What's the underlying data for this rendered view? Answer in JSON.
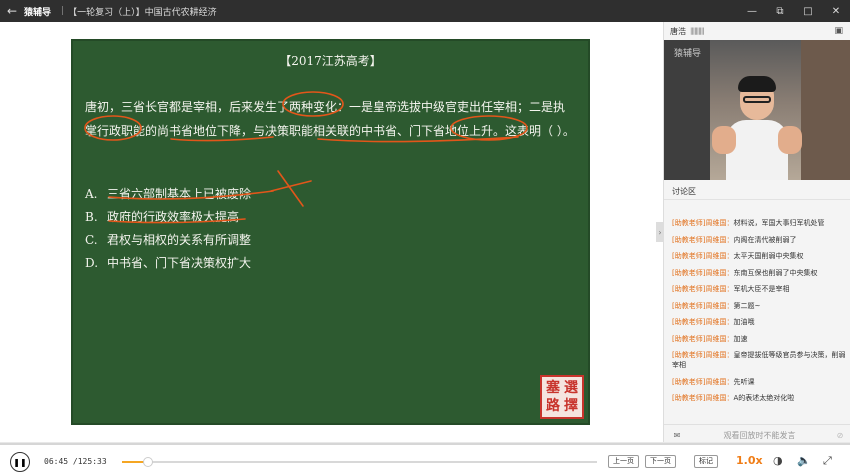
{
  "titlebar": {
    "back_icon": "arrow-left-icon",
    "app_name": "猿辅导",
    "separator": "|",
    "course_title": "【一轮复习（上）】中国古代农耕经济",
    "controls": [
      "minimize-icon",
      "restore-icon",
      "maximize-icon",
      "close-icon"
    ]
  },
  "board": {
    "title": "【2017江苏高考】",
    "question": "唐初，三省长官都是宰相，后来发生了两种变化：一是皇帝选拔中级官吏出任宰相；二是执掌行政职能的尚书省地位下降，与决策职能相关联的中书省、门下省地位上升。这表明（ ）。",
    "options": [
      {
        "key": "A.",
        "text": "三省六部制基本上已被废除"
      },
      {
        "key": "B.",
        "text": "政府的行政效率极大提高"
      },
      {
        "key": "C.",
        "text": "君权与相权的关系有所调整"
      },
      {
        "key": "D.",
        "text": "中书省、门下省决策权扩大"
      }
    ],
    "seal_chars": [
      "選",
      "塞",
      "擇",
      "路"
    ],
    "ink_color": "#e2561a"
  },
  "teacher": {
    "name": "唐浩",
    "signal": "||||||||||",
    "camera_icon": "camera-off-icon",
    "watermark": "猿辅导"
  },
  "discussion": {
    "title": "讨论区",
    "collapse_icon": "chevron-right-icon",
    "messages": [
      {
        "who": "[助教老师]周维国：",
        "text": "材料说，军国大事归军机处管"
      },
      {
        "who": "[助教老师]周维国：",
        "text": "内阁在清代被削弱了"
      },
      {
        "who": "[助教老师]周维国：",
        "text": "太平天国削弱中央集权"
      },
      {
        "who": "[助教老师]周维国：",
        "text": "东南互保也削弱了中央集权"
      },
      {
        "who": "[助教老师]周维国：",
        "text": "军机大臣不是宰相"
      },
      {
        "who": "[助教老师]周维国：",
        "text": "第二题~"
      },
      {
        "who": "[助教老师]周维国：",
        "text": "加油哦"
      },
      {
        "who": "[助教老师]周维国：",
        "text": "加速"
      },
      {
        "who": "[助教老师]周维国：",
        "text": "皇帝提拔低等级官员参与决策，削弱宰相"
      },
      {
        "who": "[助教老师]周维国：",
        "text": "先听课"
      },
      {
        "who": "[助教老师]周维国：",
        "text": "A的表述太绝对化啦"
      }
    ],
    "input_placeholder": "观看回放时不能发言",
    "input_icon": "chat-icon",
    "disabled_icon": "forbidden-icon"
  },
  "player": {
    "play_icon": "pause-icon",
    "current_time": "06:45",
    "total_time": "/125:33",
    "progress": 0.054,
    "prev_label": "上一页",
    "next_label": "下一页",
    "mark_label": "标记",
    "speed": "1.0x",
    "accent": "#f5a623",
    "right_icons": [
      "subtitle-icon",
      "volume-icon",
      "fullscreen-icon"
    ]
  }
}
